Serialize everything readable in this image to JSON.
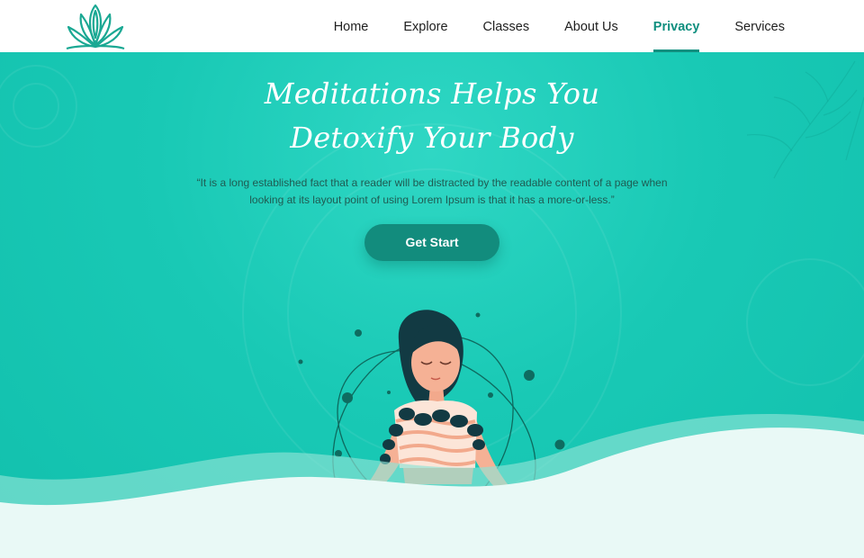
{
  "header": {
    "logo_icon": "lotus-icon",
    "nav": [
      {
        "label": "Home",
        "active": false
      },
      {
        "label": "Explore",
        "active": false
      },
      {
        "label": "Classes",
        "active": false
      },
      {
        "label": "About Us",
        "active": false
      },
      {
        "label": "Privacy",
        "active": true
      },
      {
        "label": "Services",
        "active": false
      }
    ]
  },
  "hero": {
    "title_line1": "Meditations Helps You",
    "title_line2": "Detoxify Your Body",
    "quote_line1": "“It is a long established fact that a reader will be distracted by the readable content of a page when",
    "quote_line2": "looking at its layout point of using Lorem Ipsum is that it has a more-or-less.”",
    "cta_label": "Get Start"
  },
  "colors": {
    "accent": "#0f8f7f",
    "hero_bg": "#19c9b5",
    "button": "#128c7d",
    "wave_light": "#e6f8f5"
  },
  "illustration_icon": "meditating-woman-illustration"
}
